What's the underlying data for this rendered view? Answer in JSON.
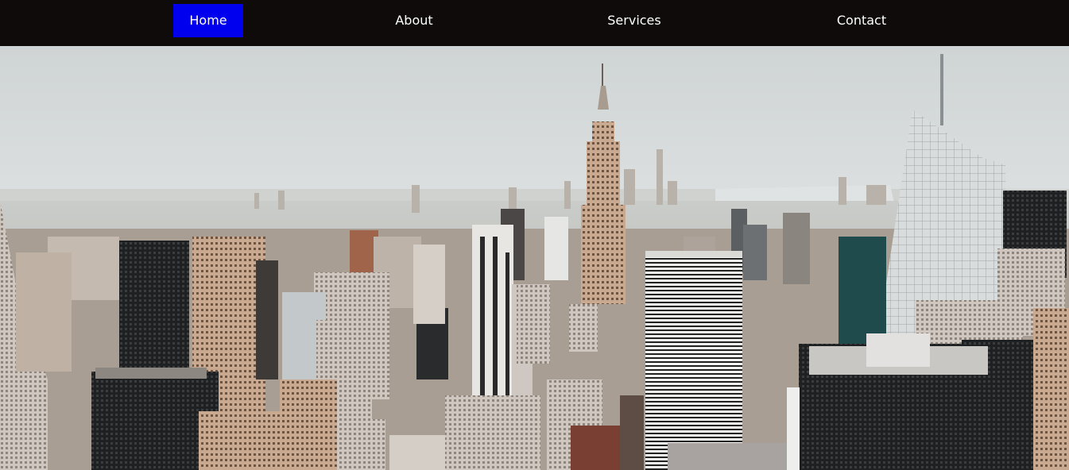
{
  "nav": {
    "items": [
      {
        "label": "Home",
        "active": true
      },
      {
        "label": "About",
        "active": false
      },
      {
        "label": "Services",
        "active": false
      },
      {
        "label": "Contact",
        "active": false
      }
    ],
    "active_color": "#0000EE",
    "background_color": "#0F0B0B"
  },
  "hero": {
    "image_subject": "aerial view of a city skyline with skyscrapers"
  }
}
